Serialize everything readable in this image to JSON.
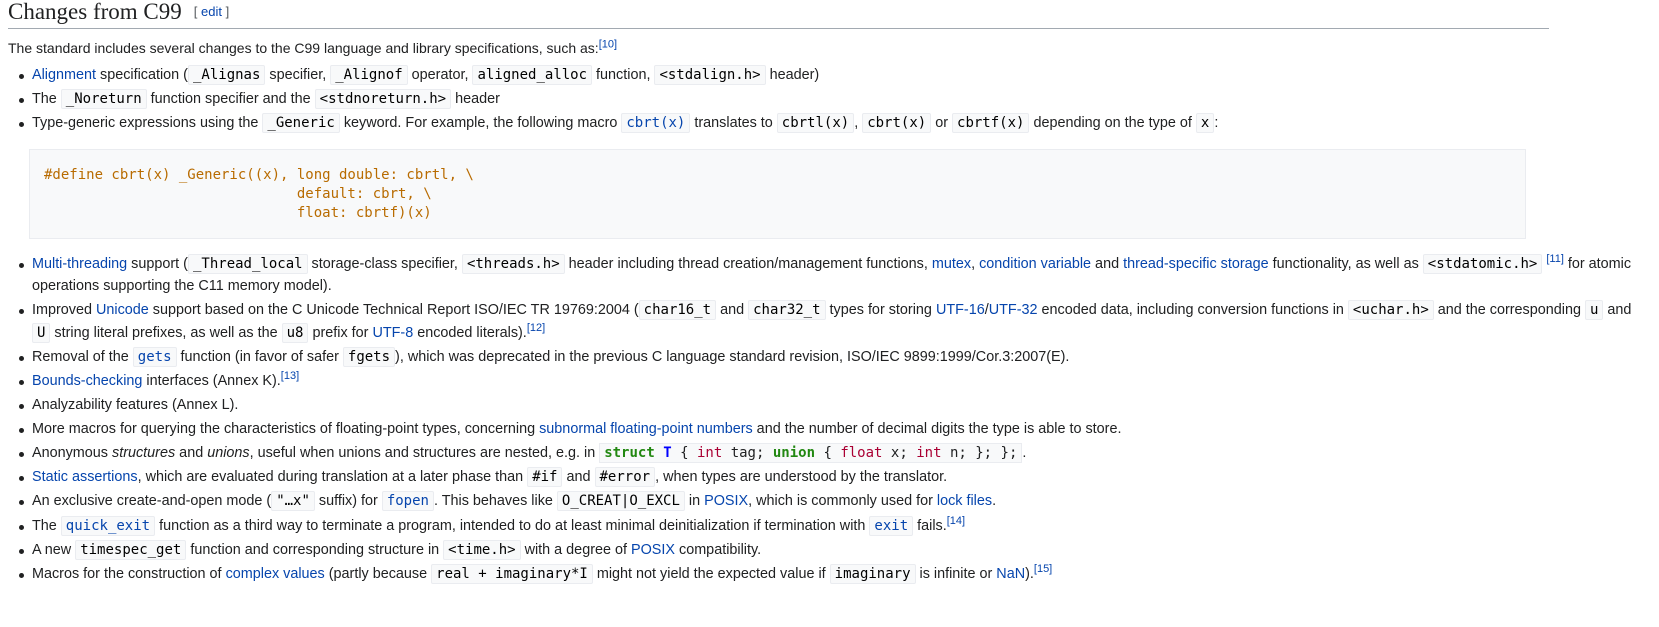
{
  "heading": {
    "title": "Changes from C99",
    "edit_open": "[ ",
    "edit": "edit",
    "edit_close": " ]"
  },
  "intro": {
    "text": "The standard includes several changes to the C99 language and library specifications, such as:",
    "ref": "[10]"
  },
  "items1": [
    [
      "Alignment",
      " specification (",
      "_Alignas",
      " specifier, ",
      "_Alignof",
      " operator, ",
      "aligned_alloc",
      " function, ",
      "<stdalign.h>",
      " header)"
    ],
    [
      "The ",
      "_Noreturn",
      " function specifier and the ",
      "<stdnoreturn.h>",
      " header"
    ],
    [
      "Type-generic expressions using the ",
      "_Generic",
      " keyword. For example, the following macro ",
      "cbrt(x)",
      " translates to ",
      "cbrtl(x)",
      ", ",
      "cbrt(x)",
      " or ",
      "cbrtf(x)",
      " depending on the type of ",
      "x",
      ":"
    ]
  ],
  "code_block": "#define cbrt(x) _Generic((x), long double: cbrtl, \\\n                              default: cbrt, \\\n                              float: cbrtf)(x)",
  "items2": {
    "mt": [
      "Multi-threading",
      " support (",
      "_Thread_local",
      " storage-class specifier, ",
      "<threads.h>",
      " header including thread creation/management functions, ",
      "mutex",
      ", ",
      "condition variable",
      " and ",
      "thread-specific storage",
      " functionality, as well as ",
      "<stdatomic.h>",
      "[11]",
      " for atomic operations supporting the C11 memory model)."
    ],
    "uni": [
      "Improved ",
      "Unicode",
      " support based on the C Unicode Technical Report ISO/IEC TR 19769:2004 (",
      "char16_t",
      " and ",
      "char32_t",
      " types for storing ",
      "UTF-16",
      "/",
      "UTF-32",
      " encoded data, including conversion functions in ",
      "<uchar.h>",
      " and the corresponding ",
      "u",
      " and ",
      "U",
      " string literal prefixes, as well as the ",
      "u8",
      " prefix for ",
      "UTF-8",
      " encoded literals).",
      "[12]"
    ],
    "gets": [
      "Removal of the ",
      "gets",
      " function (in favor of safer ",
      "fgets",
      "), which was deprecated in the previous C language standard revision, ISO/IEC 9899:1999/Cor.3:2007(E)."
    ],
    "bounds": [
      "Bounds-checking",
      " interfaces (Annex K).",
      "[13]"
    ],
    "analyz": "Analyzability features (Annex L).",
    "macros": [
      "More macros for querying the characteristics of floating-point types, concerning ",
      "subnormal floating-point numbers",
      " and the number of decimal digits the type is able to store."
    ],
    "anon": [
      "Anonymous ",
      "structures",
      " and ",
      "unions",
      ", useful when unions and structures are nested, e.g. in ",
      "struct",
      "T",
      "{",
      "int",
      "tag;",
      "union",
      "{",
      "float",
      "x;",
      "int",
      "n;",
      "};",
      "};",
      "."
    ],
    "static": [
      "Static assertions",
      ", which are evaluated during translation at a later phase than ",
      "#if",
      " and ",
      "#error",
      ", when types are understood by the translator."
    ],
    "excl": [
      "An exclusive create-and-open mode (",
      "\"…x\"",
      " suffix) for ",
      "fopen",
      ". This behaves like ",
      "O_CREAT|O_EXCL",
      " in ",
      "POSIX",
      ", which is commonly used for ",
      "lock files",
      "."
    ],
    "qexit": [
      "The ",
      "quick_exit",
      " function as a third way to terminate a program, intended to do at least minimal deinitialization if termination with ",
      "exit",
      " fails.",
      "[14]"
    ],
    "tspec": [
      "A new ",
      "timespec_get",
      " function and corresponding structure in ",
      "<time.h>",
      " with a degree of ",
      "POSIX",
      " compatibility."
    ],
    "cplx": [
      "Macros for the construction of ",
      "complex values",
      " (partly because ",
      "real + imaginary*I",
      " might not yield the expected value if ",
      "imaginary",
      " is infinite or ",
      "NaN",
      ").",
      "[15]"
    ]
  }
}
